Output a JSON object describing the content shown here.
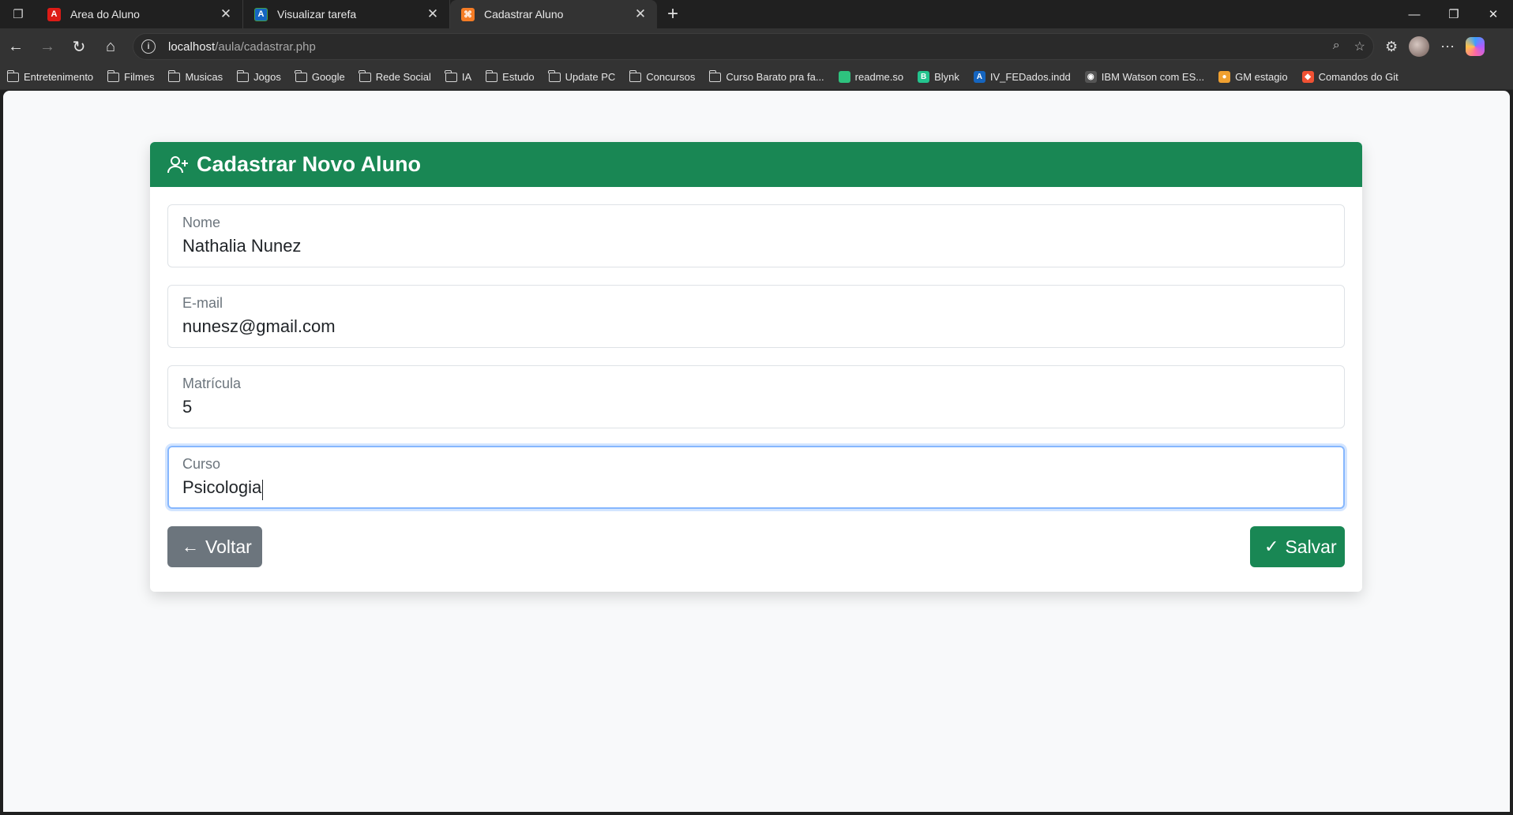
{
  "browser": {
    "tabs": [
      {
        "title": "Area do Aluno",
        "favicon_color": "#dd1b16",
        "favicon_glyph": "A"
      },
      {
        "title": "Visualizar tarefa",
        "favicon_color": "#1565c0",
        "favicon_glyph": "A"
      },
      {
        "title": "Cadastrar Aluno",
        "favicon_color": "#f57c25",
        "favicon_glyph": "⌘"
      }
    ],
    "url_host": "localhost",
    "url_path": "/aula/cadastrar.php",
    "bookmarks": [
      {
        "label": "Entretenimento",
        "type": "folder"
      },
      {
        "label": "Filmes",
        "type": "folder"
      },
      {
        "label": "Musicas",
        "type": "folder"
      },
      {
        "label": "Jogos",
        "type": "folder"
      },
      {
        "label": "Google",
        "type": "folder"
      },
      {
        "label": "Rede Social",
        "type": "folder"
      },
      {
        "label": "IA",
        "type": "folder"
      },
      {
        "label": "Estudo",
        "type": "folder"
      },
      {
        "label": "Update PC",
        "type": "folder"
      },
      {
        "label": "Concursos",
        "type": "folder"
      },
      {
        "label": "Curso Barato pra fa...",
        "type": "folder"
      },
      {
        "label": "readme.so",
        "type": "site",
        "color": "#2ec27e",
        "glyph": ""
      },
      {
        "label": "Blynk",
        "type": "site",
        "color": "#23c48e",
        "glyph": "B"
      },
      {
        "label": "IV_FEDados.indd",
        "type": "site",
        "color": "#1565c0",
        "glyph": "A"
      },
      {
        "label": "IBM Watson com ES...",
        "type": "site",
        "color": "#555555",
        "glyph": "◉"
      },
      {
        "label": "GM estagio",
        "type": "site",
        "color": "#f0a030",
        "glyph": "●"
      },
      {
        "label": "Comandos do Git",
        "type": "site",
        "color": "#f05133",
        "glyph": "◆"
      }
    ]
  },
  "form": {
    "title": "Cadastrar Novo Aluno",
    "fields": [
      {
        "label": "Nome",
        "value": "Nathalia Nunez"
      },
      {
        "label": "E-mail",
        "value": "nunesz@gmail.com"
      },
      {
        "label": "Matrícula",
        "value": "5"
      },
      {
        "label": "Curso",
        "value": "Psicologia"
      }
    ],
    "back_label": "Voltar",
    "save_label": "Salvar"
  },
  "colors": {
    "primary_green": "#198754",
    "secondary_gray": "#6c757d",
    "focus_border": "#86b7fe"
  }
}
